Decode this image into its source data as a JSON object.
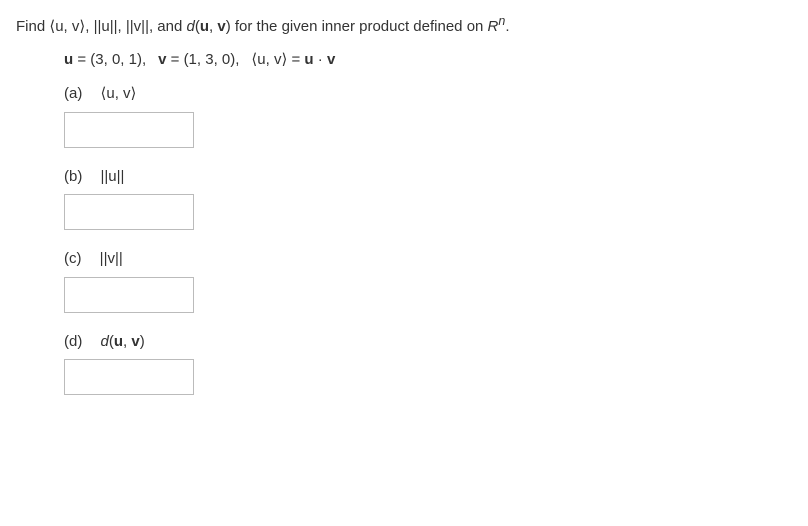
{
  "prompt": {
    "prefix": "Find ",
    "ip": "⟨u, v⟩",
    "sep1": ", ",
    "nu": "||u||",
    "sep2": ", ",
    "nv": "||v||",
    "sep3": ", and ",
    "d": "d",
    "dargs_open": "(",
    "du": "u",
    "dcomma": ", ",
    "dv": "v",
    "dargs_close": ")",
    "tail1": " for the given inner product defined on ",
    "rn": "R",
    "rn_sup": "n",
    "period": "."
  },
  "vectors": {
    "u_lbl": "u",
    "u_eq": " = (3, 0, 1),",
    "v_lbl": "v",
    "v_eq": " = (1, 3, 0),",
    "ip": "⟨u, v⟩",
    "ip_eq": " = ",
    "ip_u": "u",
    "dot": " · ",
    "ip_v": "v"
  },
  "parts": {
    "a": {
      "label": "(a)",
      "expr": "⟨u, v⟩"
    },
    "b": {
      "label": "(b)",
      "expr": "||u||"
    },
    "c": {
      "label": "(c)",
      "expr": "||v||"
    },
    "d": {
      "label": "(d)",
      "d_letter": "d",
      "open": "(",
      "u": "u",
      "comma": ", ",
      "v": "v",
      "close": ")"
    }
  }
}
